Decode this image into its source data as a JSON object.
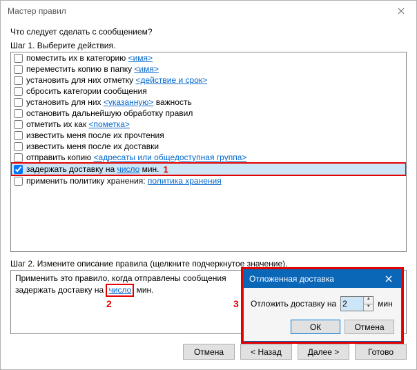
{
  "window": {
    "title": "Мастер правил"
  },
  "prompt": "Что следует сделать с сообщением?",
  "step1_heading": "Шаг 1. Выберите действия.",
  "step2_heading": "Шаг 2. Измените описание правила (щелкните подчеркнутое значение).",
  "actions": [
    {
      "checked": false,
      "parts": [
        {
          "t": "поместить их в категорию "
        },
        {
          "t": "<имя>",
          "link": true
        }
      ]
    },
    {
      "checked": false,
      "parts": [
        {
          "t": "переместить копию в папку "
        },
        {
          "t": "<имя>",
          "link": true
        }
      ]
    },
    {
      "checked": false,
      "parts": [
        {
          "t": "установить для них отметку "
        },
        {
          "t": "<действие и срок>",
          "link": true
        }
      ]
    },
    {
      "checked": false,
      "parts": [
        {
          "t": "сбросить категории сообщения"
        }
      ]
    },
    {
      "checked": false,
      "parts": [
        {
          "t": "установить для них "
        },
        {
          "t": "<указанную>",
          "link": true
        },
        {
          "t": " важность"
        }
      ]
    },
    {
      "checked": false,
      "parts": [
        {
          "t": "остановить дальнейшую обработку правил"
        }
      ]
    },
    {
      "checked": false,
      "parts": [
        {
          "t": "отметить их как "
        },
        {
          "t": "<пометка>",
          "link": true
        }
      ]
    },
    {
      "checked": false,
      "parts": [
        {
          "t": "известить меня после их прочтения"
        }
      ]
    },
    {
      "checked": false,
      "parts": [
        {
          "t": "известить меня после их доставки"
        }
      ]
    },
    {
      "checked": false,
      "parts": [
        {
          "t": "отправить копию "
        },
        {
          "t": "<адресаты или общедоступная группа>",
          "link": true
        }
      ]
    },
    {
      "checked": true,
      "parts": [
        {
          "t": "задержать доставку на "
        },
        {
          "t": "число",
          "link": true
        },
        {
          "t": " мин."
        }
      ],
      "selected": true,
      "annot": "1"
    },
    {
      "checked": false,
      "parts": [
        {
          "t": "применить политику хранения: "
        },
        {
          "t": "политика хранения",
          "link": true
        }
      ]
    }
  ],
  "description": {
    "line1": "Применить это правило, когда отправлены сообщения",
    "line2_prefix": "задержать доставку на ",
    "line2_link": "число",
    "line2_suffix": " мин."
  },
  "annot": {
    "a1": "1",
    "a2": "2",
    "a3": "3"
  },
  "inner_dialog": {
    "title": "Отложенная доставка",
    "label": "Отложить доставку на",
    "value": "2",
    "unit": "мин",
    "ok": "ОК",
    "cancel": "Отмена"
  },
  "buttons": {
    "cancel": "Отмена",
    "back": "< Назад",
    "next": "Далее >",
    "finish": "Готово"
  }
}
